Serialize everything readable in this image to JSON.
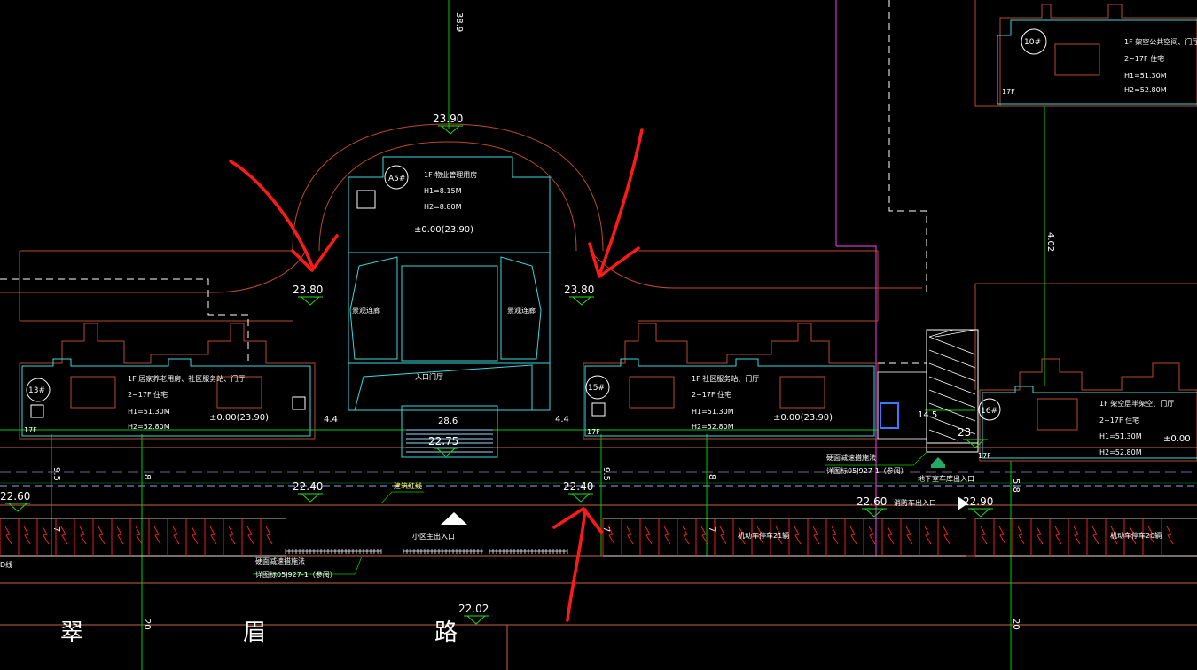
{
  "drawing": {
    "colors": {
      "background": "#000000",
      "grid_line": "#00cc00",
      "building_outline": "#b84a2a",
      "pavilion_outline": "#39d8e0",
      "road_line": "#c8624a",
      "boundary_dash": "#ffffff",
      "magenta_line": "#cc33cc",
      "fence_red": "#ff2222",
      "marker_red": "#ff1a1a",
      "level_mark": "#22dd22"
    },
    "grid_top_label": "38.9",
    "road_name_chars": [
      "翠",
      "眉",
      "路"
    ],
    "pavilion": {
      "tag": "A5#",
      "desc": "1F  物业管理用房",
      "h1": "H1=8.15M",
      "h2": "H2=8.80M",
      "level": "±0.00(23.90)",
      "left_label": "景观连廊",
      "right_label": "景观连廊",
      "entrance": "入口门厅",
      "width_dim": "28.6",
      "side_dim_left": "4.4",
      "side_dim_right": "4.4"
    },
    "buildings": [
      {
        "tag": "13#",
        "line1": "1F 居家养老用房、社区服务站、门厅",
        "line2": "2~17F 住宅",
        "h1": "H1=51.30M",
        "h2": "H2=52.80M",
        "level": "±0.00(23.90)",
        "floors": "17F"
      },
      {
        "tag": "15#",
        "line1": "1F 社区服务站、门厅",
        "line2": "2~17F 住宅",
        "h1": "H1=51.30M",
        "h2": "H2=52.80M",
        "level": "±0.00(23.90)",
        "floors": "17F"
      },
      {
        "tag": "16#",
        "line1": "1F 架空层半架空、门厅",
        "line2": "2~17F 住宅",
        "h1": "H1=51.30M",
        "h2": "H2=52.80M",
        "level": "±0.00",
        "floors": "17F"
      },
      {
        "tag": "10#",
        "line1": "1F 架空公共空间、门厅",
        "line2": "2~17F 住宅",
        "h1": "H1=51.30M",
        "h2": "H2=52.80M",
        "level": "",
        "floors": "17F"
      }
    ],
    "elevations": [
      {
        "id": "top-arc",
        "value": "23.90"
      },
      {
        "id": "left-arc",
        "value": "23.80"
      },
      {
        "id": "right-arc",
        "value": "23.80"
      },
      {
        "id": "stair",
        "value": "22.75"
      },
      {
        "id": "setback-left",
        "value": "22.40"
      },
      {
        "id": "setback-mid",
        "value": "22.40"
      },
      {
        "id": "far-left",
        "value": "22.60"
      },
      {
        "id": "right-road",
        "value": "22.60"
      },
      {
        "id": "right-road-2",
        "value": "22.90"
      },
      {
        "id": "road",
        "value": "22.02"
      },
      {
        "id": "ramp",
        "value": "23"
      }
    ],
    "dimensions": [
      "9.5",
      "8",
      "9.5",
      "8",
      "5.8",
      "4.02",
      "7",
      "7",
      "7",
      "20",
      "20",
      "14.5"
    ],
    "annotations": {
      "building_line": "建筑红线",
      "main_entrance": "小区主出入口",
      "detail_note_1": "硬面减速措施法",
      "detail_note_1b": "详图标05J927-1（参阅）",
      "detail_note_2": "硬面减速措施法",
      "detail_note_2b": "详图标05J927-1（参阅）",
      "garage_entry": "地下室车库出入口",
      "fire_entry": "消防车出入口",
      "parking_1": "机动车停车21辆",
      "parking_2": "机动车停车20辆",
      "left_edge": "D线"
    }
  }
}
